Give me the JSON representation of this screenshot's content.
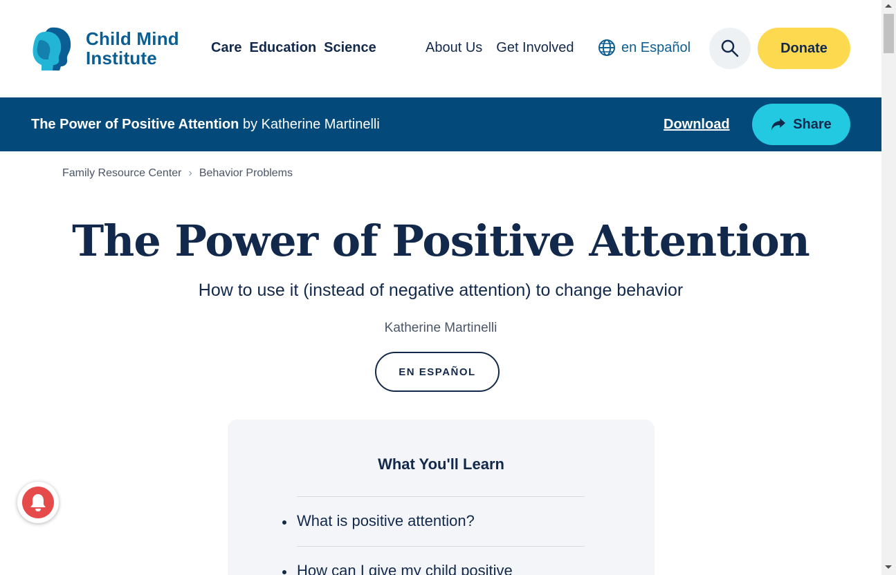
{
  "header": {
    "logo_line1": "Child Mind",
    "logo_line2": "Institute",
    "primary_nav": [
      "Care",
      "Education",
      "Science"
    ],
    "secondary_nav": [
      "About Us",
      "Get Involved"
    ],
    "language_link": "en Español",
    "donate_label": "Donate",
    "brand_color": "#0b5e93",
    "donate_color": "#fdd94f"
  },
  "title_bar": {
    "title": "The Power of Positive Attention",
    "by_author": " by Katherine Martinelli",
    "download_label": "Download",
    "share_label": "Share",
    "background_color": "#034a7a",
    "share_color": "#22c9e0"
  },
  "breadcrumb": {
    "items": [
      "Family Resource Center",
      "Behavior Problems"
    ]
  },
  "article": {
    "title": "The Power of Positive Attention",
    "subtitle": "How to use it (instead of negative attention) to change behavior",
    "author": "Katherine Martinelli",
    "spanish_button": "EN ESPAÑOL"
  },
  "learn": {
    "heading": "What You'll Learn",
    "items": [
      "What is positive attention?",
      "How can I give my child positive"
    ]
  },
  "notification": {
    "icon": "bell-icon",
    "color": "#e54b4b"
  }
}
